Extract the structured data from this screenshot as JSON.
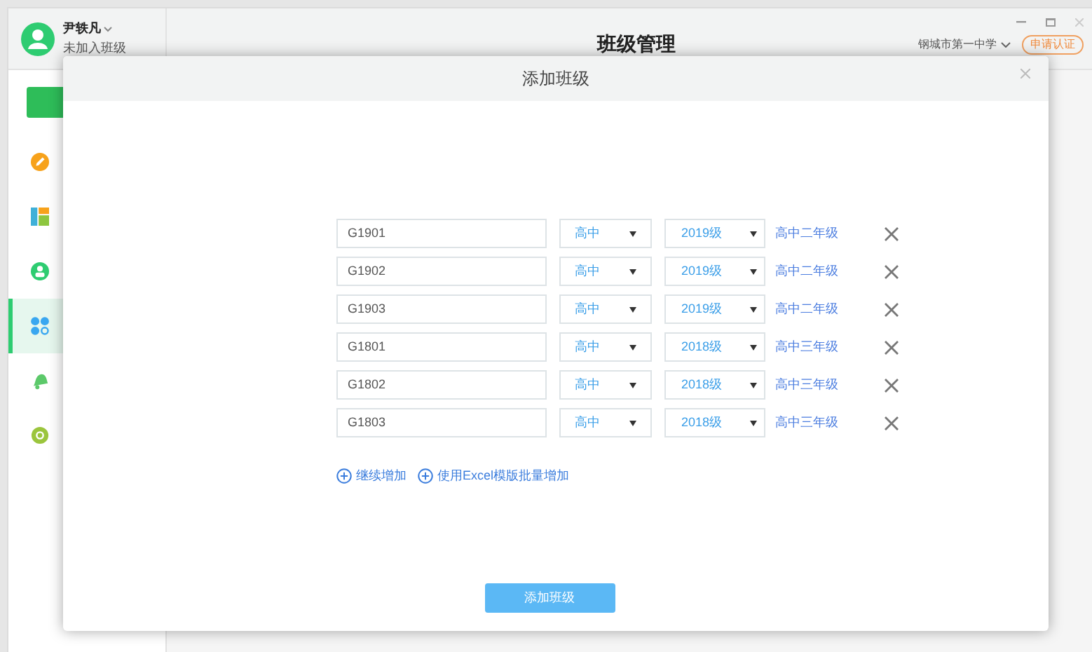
{
  "user": {
    "name": "尹轶凡",
    "status": "未加入班级"
  },
  "header": {
    "title": "班级管理",
    "school": "钢城市第一中学",
    "certify_button": "申请认证"
  },
  "sidebar": {
    "items": [
      {
        "kind": "pen",
        "selected": false
      },
      {
        "kind": "grid",
        "selected": false
      },
      {
        "kind": "person",
        "selected": false
      },
      {
        "kind": "dots",
        "selected": true
      },
      {
        "kind": "bell",
        "selected": false
      },
      {
        "kind": "gear",
        "selected": false
      }
    ]
  },
  "dialog": {
    "title": "添加班级",
    "rows": [
      {
        "name": "G1901",
        "stage": "高中",
        "year": "2019级",
        "grade": "高中二年级"
      },
      {
        "name": "G1902",
        "stage": "高中",
        "year": "2019级",
        "grade": "高中二年级"
      },
      {
        "name": "G1903",
        "stage": "高中",
        "year": "2019级",
        "grade": "高中二年级"
      },
      {
        "name": "G1801",
        "stage": "高中",
        "year": "2018级",
        "grade": "高中三年级"
      },
      {
        "name": "G1802",
        "stage": "高中",
        "year": "2018级",
        "grade": "高中三年级"
      },
      {
        "name": "G1803",
        "stage": "高中",
        "year": "2018级",
        "grade": "高中三年级"
      }
    ],
    "links": [
      "继续增加",
      "使用Excel模版批量增加"
    ],
    "submit": "添加班级"
  }
}
